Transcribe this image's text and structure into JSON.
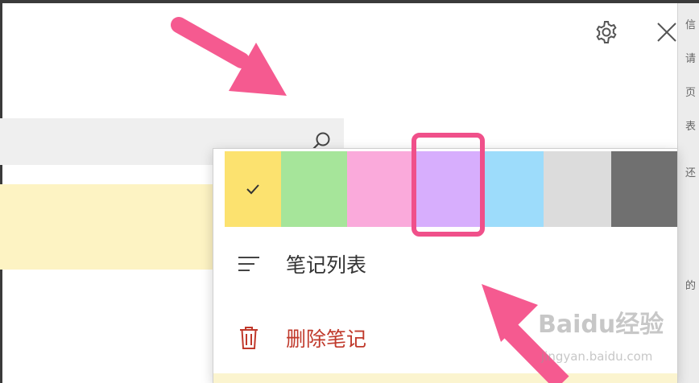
{
  "window": {
    "settings_icon": "gear-icon",
    "close_icon": "close-icon"
  },
  "search": {
    "icon": "search-icon",
    "background": "#efefef"
  },
  "note_card": {
    "color": "#fdf3c3"
  },
  "menu": {
    "swatches": [
      {
        "name": "yellow",
        "color": "#fce26f",
        "selected": true
      },
      {
        "name": "green",
        "color": "#a6e59a",
        "selected": false
      },
      {
        "name": "pink",
        "color": "#faaadb",
        "selected": false
      },
      {
        "name": "purple",
        "color": "#d7aefd",
        "selected": false
      },
      {
        "name": "blue",
        "color": "#9ddcfb",
        "selected": false
      },
      {
        "name": "gray",
        "color": "#dcdcdc",
        "selected": false
      },
      {
        "name": "charcoal",
        "color": "#707070",
        "selected": false
      }
    ],
    "note_list_label": "笔记列表",
    "note_list_icon": "list-icon",
    "delete_label": "删除笔记",
    "delete_icon": "trash-icon",
    "delete_color": "#c0392b"
  },
  "annotation": {
    "highlight_color": "#f0508a",
    "arrow_color": "#f55a90"
  },
  "watermark": {
    "main": "Baidu经验",
    "sub": "jingyan.baidu.com"
  },
  "right_strip_chars": [
    "信",
    "请",
    "页",
    "表",
    "还",
    "的"
  ]
}
